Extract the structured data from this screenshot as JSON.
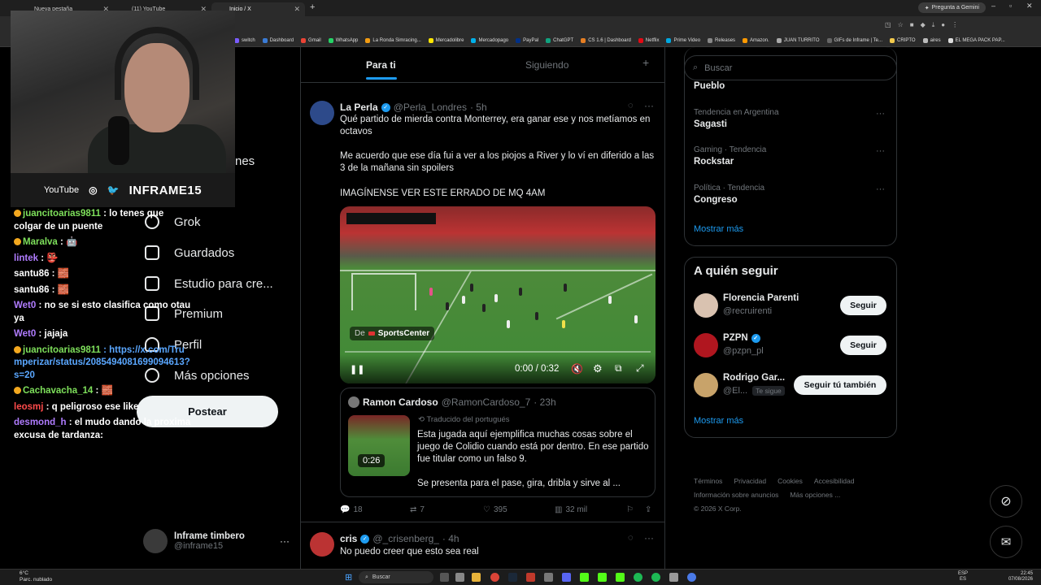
{
  "browser": {
    "tabs": [
      {
        "label": "Nueva pestaña"
      },
      {
        "label": "(11) YouTube"
      },
      {
        "label": "Inicio / X"
      }
    ],
    "gemini_label": "Pregunta a Gemini",
    "bookmarks": [
      "switch",
      "Dashboard",
      "Gmail",
      "WhatsApp",
      "La Ronda Simracing...",
      "Mercadolibre",
      "Mercadopago",
      "PayPal",
      "ChatGPT",
      "CS 1.6 | Dashboard",
      "Netflix",
      "Prime Video",
      "Releases",
      "Amazon.",
      "JUAN TURRITO",
      "GIFs de Inframe | Te...",
      "CRIPTO",
      "aires",
      "EL MEGA PACK PAP..."
    ]
  },
  "overlay": {
    "social_youtube": "YouTube",
    "channel": "INFRAME15"
  },
  "chat": [
    {
      "user": "juancitoarias9811",
      "color": "#7ee05b",
      "badge": true,
      "text": ": lo tenes que colgar de un puente"
    },
    {
      "user": "Maralva",
      "color": "#7ee05b",
      "badge": true,
      "text": ": 🤖"
    },
    {
      "user": "lintek",
      "color": "#b07cff",
      "badge": false,
      "text": ": 👺"
    },
    {
      "user": "santu86",
      "color": "#ffffff",
      "badge": false,
      "text": ": 🧱"
    },
    {
      "user": "santu86",
      "color": "#ffffff",
      "badge": false,
      "text": ": 🧱"
    },
    {
      "user": "Wet0",
      "color": "#b07cff",
      "badge": false,
      "text": ": no se si esto clasifica como otau ya"
    },
    {
      "user": "Wet0",
      "color": "#b07cff",
      "badge": false,
      "text": ": jajaja"
    },
    {
      "user": "juancitoarias9811",
      "color": "#7ee05b",
      "badge": true,
      "text": ": https://x.com/Trumperizar/status/2085494081699094613?s=20"
    },
    {
      "user": "Cachavacha_14",
      "color": "#7ee05b",
      "badge": true,
      "text": ": 🧱"
    },
    {
      "user": "leosmj",
      "color": "#ff4b4b",
      "badge": false,
      "text": ": q peligroso ese like"
    },
    {
      "user": "desmond_h",
      "color": "#b07cff",
      "badge": false,
      "text": ": el mudo dando la proxima excusa de tardanza:"
    }
  ],
  "nav": {
    "partial_label": "nes",
    "items": [
      "Grok",
      "Guardados",
      "Estudio para cre...",
      "Premium",
      "Perfil",
      "Más opciones"
    ],
    "post_label": "Postear"
  },
  "profile": {
    "name": "Inframe timbero",
    "handle": "@inframe15"
  },
  "timeline": {
    "tab_for_you": "Para ti",
    "tab_following": "Siguiendo",
    "tweet1": {
      "name": "La Perla",
      "handle": "@Perla_Londres",
      "time": "· 5h",
      "p1": "Qué partido de mierda contra Monterrey, era ganar ese y nos metíamos en octavos",
      "p2": "Me acuerdo que ese día fui a ver a los piojos a River y lo ví en diferido a las 3 de la mañana sin spoilers",
      "p3": "IMAGÍNENSE VER ESTE ERRADO DE MQ 4AM",
      "video_source_prefix": "De",
      "video_source": "SportsCenter",
      "video_time": "0:00 / 0:32",
      "quote": {
        "name": "Ramon Cardoso",
        "handle": "@RamonCardoso_7",
        "time": "· 23h",
        "translated": "Traducido del portugués",
        "text": "Esta jugada aquí ejemplifica muchas cosas sobre el juego de Colidio cuando está por dentro. En ese partido fue titular como un falso 9.",
        "text2": "Se presenta para el pase, gira, dribla y sirve al ...",
        "thumb_duration": "0:26"
      },
      "replies": "18",
      "reposts": "7",
      "likes": "395",
      "views": "32 mil"
    },
    "tweet2": {
      "name": "cris",
      "handle": "@_crisenberg_",
      "time": "· 4h",
      "text": "No puedo creer que esto sea real"
    }
  },
  "sidebar": {
    "search_placeholder": "Buscar",
    "trends": [
      {
        "category": "",
        "name": "Pueblo"
      },
      {
        "category": "Tendencia en Argentina",
        "name": "Sagasti"
      },
      {
        "category": "Gaming · Tendencia",
        "name": "Rockstar"
      },
      {
        "category": "Política · Tendencia",
        "name": "Congreso"
      }
    ],
    "show_more": "Mostrar más",
    "who_to_follow_title": "A quién seguir",
    "follow": [
      {
        "name": "Florencia Parenti",
        "handle": "@recruirenti",
        "button": "Seguir"
      },
      {
        "name": "PZPN",
        "handle": "@pzpn_pl",
        "button": "Seguir"
      },
      {
        "name": "Rodrigo Gar...",
        "handle": "@El...",
        "follows_you": "Te sigue",
        "button": "Seguir tú también"
      }
    ],
    "footer": {
      "line1": [
        "Términos",
        "Privacidad",
        "Cookies",
        "Accesibilidad"
      ],
      "line2": [
        "Información sobre anuncios",
        "Más opciones ..."
      ],
      "copyright": "© 2026 X Corp."
    }
  },
  "taskbar": {
    "weather_temp": "6°C",
    "weather_desc": "Parc. nublado",
    "search_label": "Buscar",
    "lang": "ESP",
    "lang2": "ES",
    "time": "22:45",
    "date": "07/08/2026"
  }
}
